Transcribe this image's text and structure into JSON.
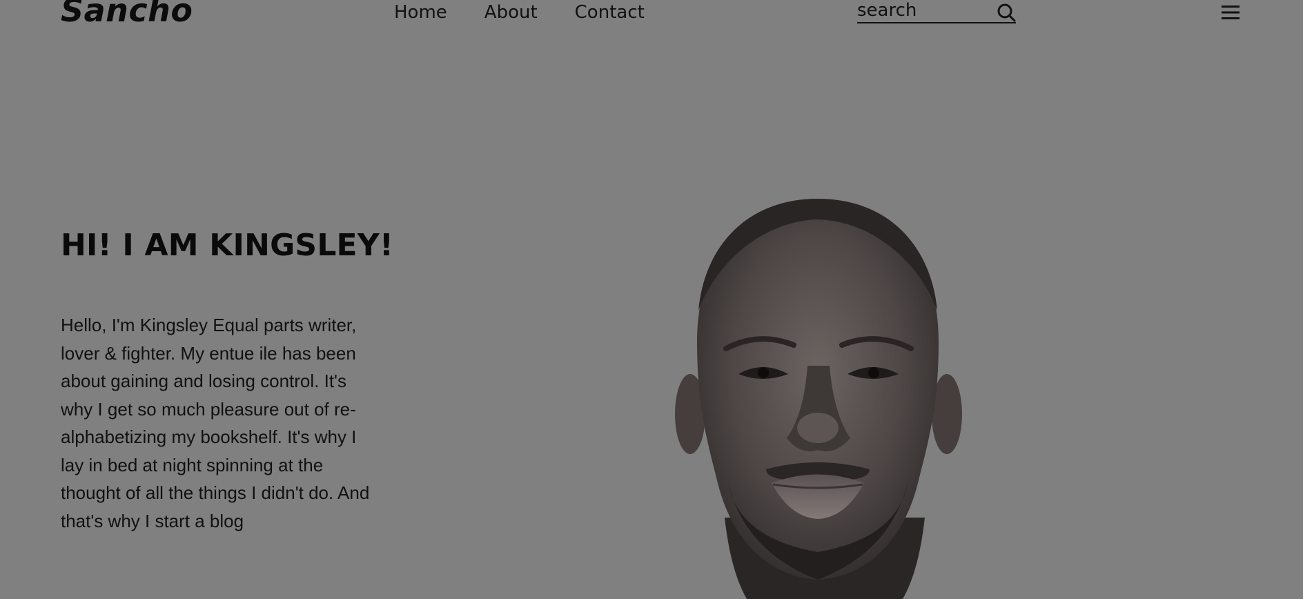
{
  "header": {
    "logo": "Sancho",
    "nav": [
      {
        "label": "Home"
      },
      {
        "label": "About"
      },
      {
        "label": "Contact"
      }
    ],
    "search": {
      "placeholder": "search",
      "icon": "search-icon"
    },
    "menu_icon": "hamburger-menu-icon"
  },
  "hero": {
    "title": "HI! I AM KINGSLEY!",
    "paragraph": "Hello, I'm Kingsley Equal parts writer, lover & fighter. My entue ile has been about gaining and losing control. It's why I get so much pleasure out of re-alphabetizing my bookshelf. It's why I lay in bed at night spinning at the thought of all the things I didn't do. And that's why I start a blog",
    "image": "portrait-photo"
  },
  "colors": {
    "background": "#808080",
    "text": "#111111"
  }
}
